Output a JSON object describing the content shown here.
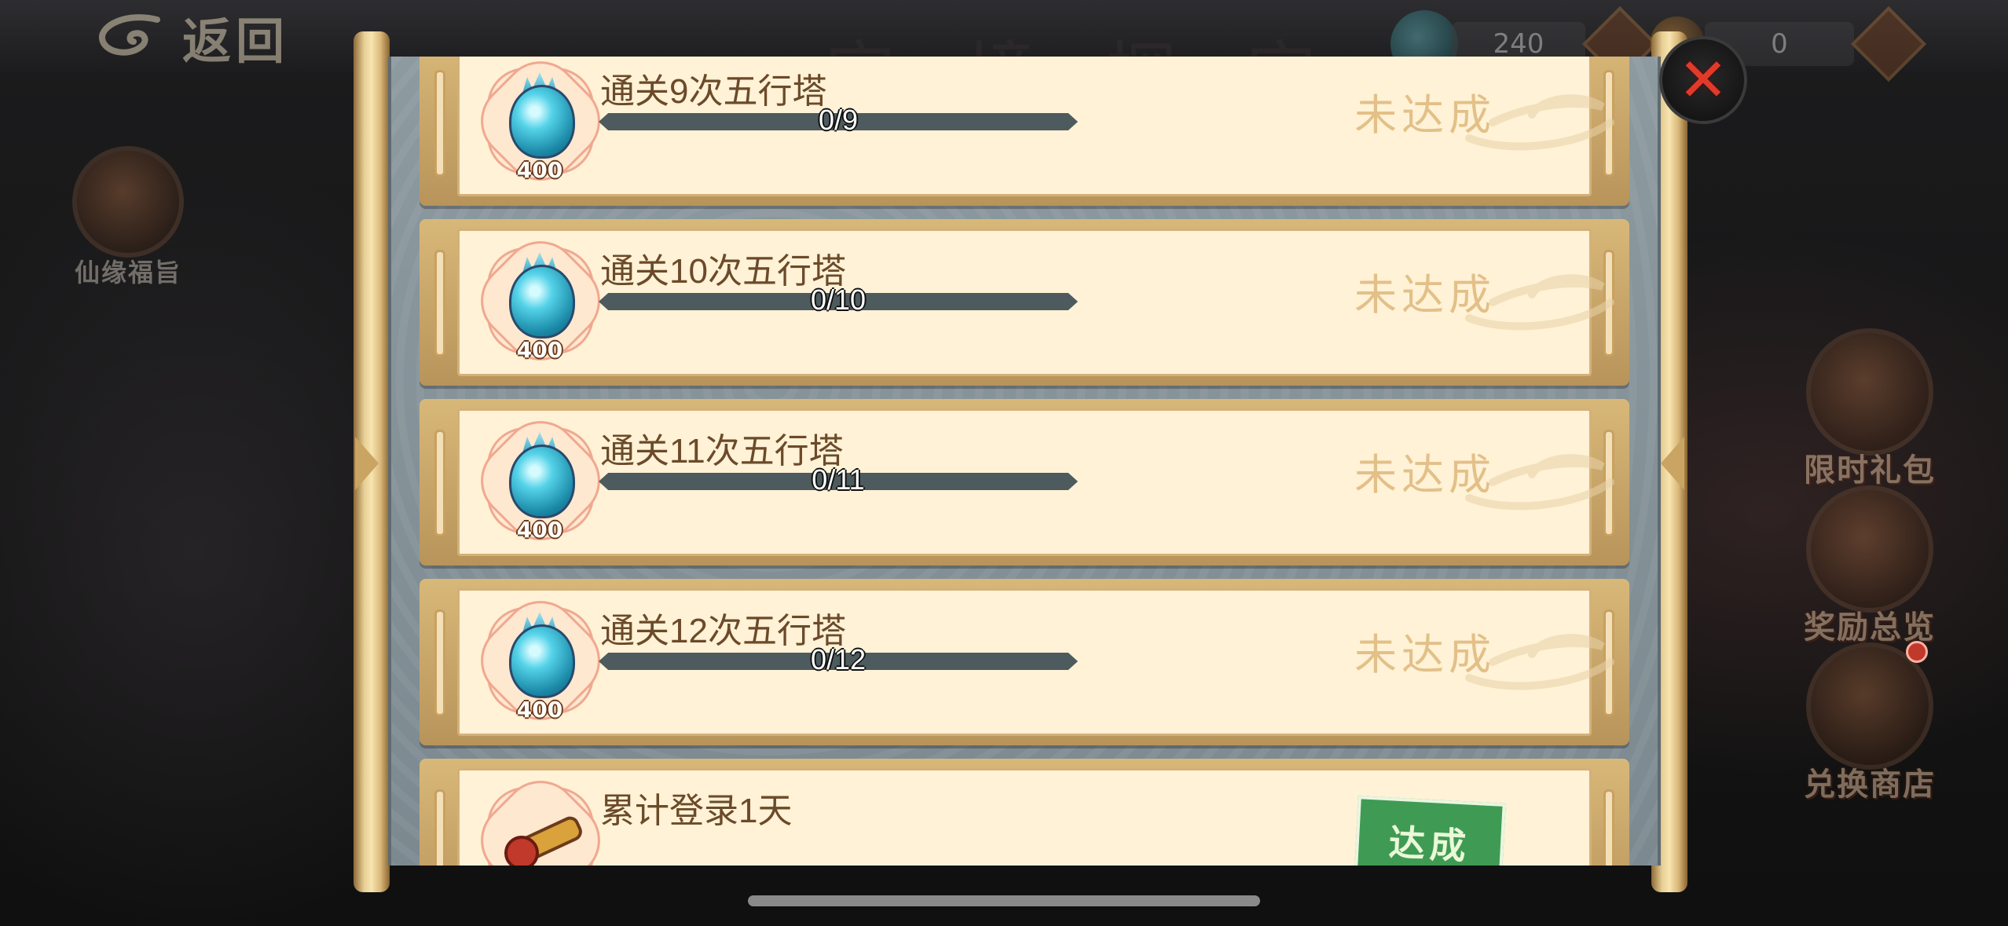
{
  "header": {
    "back_label": "返回",
    "currency": [
      {
        "icon": "jade-dragon-icon",
        "value": "240"
      },
      {
        "icon": "telescope-icon",
        "value": "0"
      }
    ]
  },
  "left_sidebar": [
    {
      "icon": "scroll-icon",
      "label": "仙缘福旨"
    }
  ],
  "right_sidebar": [
    {
      "icon": "gift-pack-icon",
      "label": "限时礼包"
    },
    {
      "icon": "reward-book-icon",
      "label": "奖励总览"
    },
    {
      "icon": "shop-icon",
      "label": "兑换商店",
      "has_notification": true
    }
  ],
  "tasks": [
    {
      "title": "通关9次五行塔",
      "progress_text": "0/9",
      "progress": 0,
      "reward_icon": "jade-gem-icon",
      "reward_count": "400",
      "status": "未达成"
    },
    {
      "title": "通关10次五行塔",
      "progress_text": "0/10",
      "progress": 0,
      "reward_icon": "jade-gem-icon",
      "reward_count": "400",
      "status": "未达成"
    },
    {
      "title": "通关11次五行塔",
      "progress_text": "0/11",
      "progress": 0,
      "reward_icon": "jade-gem-icon",
      "reward_count": "400",
      "status": "未达成"
    },
    {
      "title": "通关12次五行塔",
      "progress_text": "0/12",
      "progress": 0,
      "reward_icon": "jade-gem-icon",
      "reward_count": "400",
      "status": "未达成"
    },
    {
      "title": "累计登录1天",
      "reward_icon": "telescope-icon",
      "status": "达成"
    }
  ],
  "colors": {
    "status_pending": "#e3c089",
    "status_done": "#3f9b54",
    "close": "#e23a2a"
  }
}
